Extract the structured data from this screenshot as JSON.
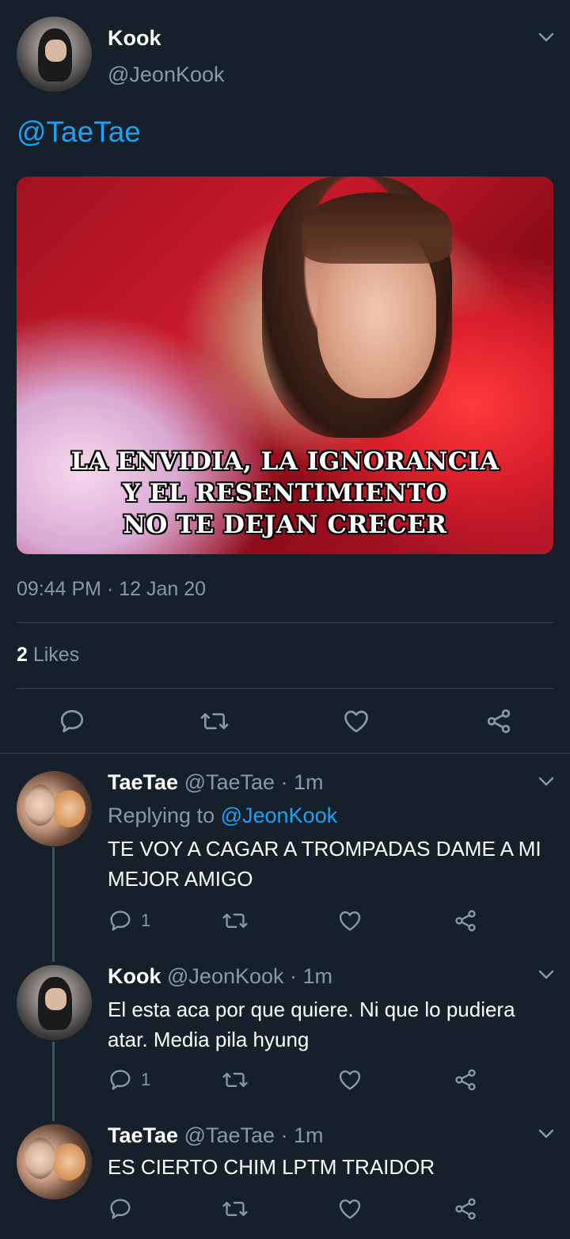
{
  "main_tweet": {
    "name": "Kook",
    "handle": "@JeonKook",
    "text": "@TaeTae",
    "image_caption": [
      "LA ENVIDIA, LA IGNORANCIA",
      "Y EL RESENTIMIENTO",
      "NO TE DEJAN CRECER"
    ],
    "timestamp": "09:44 PM · 12 Jan 20",
    "likes_count": "2",
    "likes_label": " Likes",
    "icons": [
      "reply-icon",
      "retweet-icon",
      "like-icon",
      "share-icon",
      "chevron-down-icon"
    ]
  },
  "replies": [
    {
      "name": "TaeTae",
      "handle_time": "@TaeTae · 1m",
      "replying_prefix": "Replying to ",
      "replying_to": "@JeonKook",
      "text": "TE VOY A CAGAR A TROMPADAS DAME A MI MEJOR AMIGO",
      "reply_count": "1"
    },
    {
      "name": "Kook",
      "handle_time": "@JeonKook · 1m",
      "text": "El esta aca por que quiere. Ni que lo pudiera atar. Media pila hyung",
      "reply_count": "1"
    },
    {
      "name": "TaeTae",
      "handle_time": "@TaeTae · 1m",
      "text": "ES CIERTO CHIM LPTM TRAIDOR",
      "reply_count": ""
    }
  ],
  "colors": {
    "background": "#15202b",
    "accent": "#1da1f2",
    "secondary_text": "#8899a6",
    "divider": "#38444d"
  }
}
